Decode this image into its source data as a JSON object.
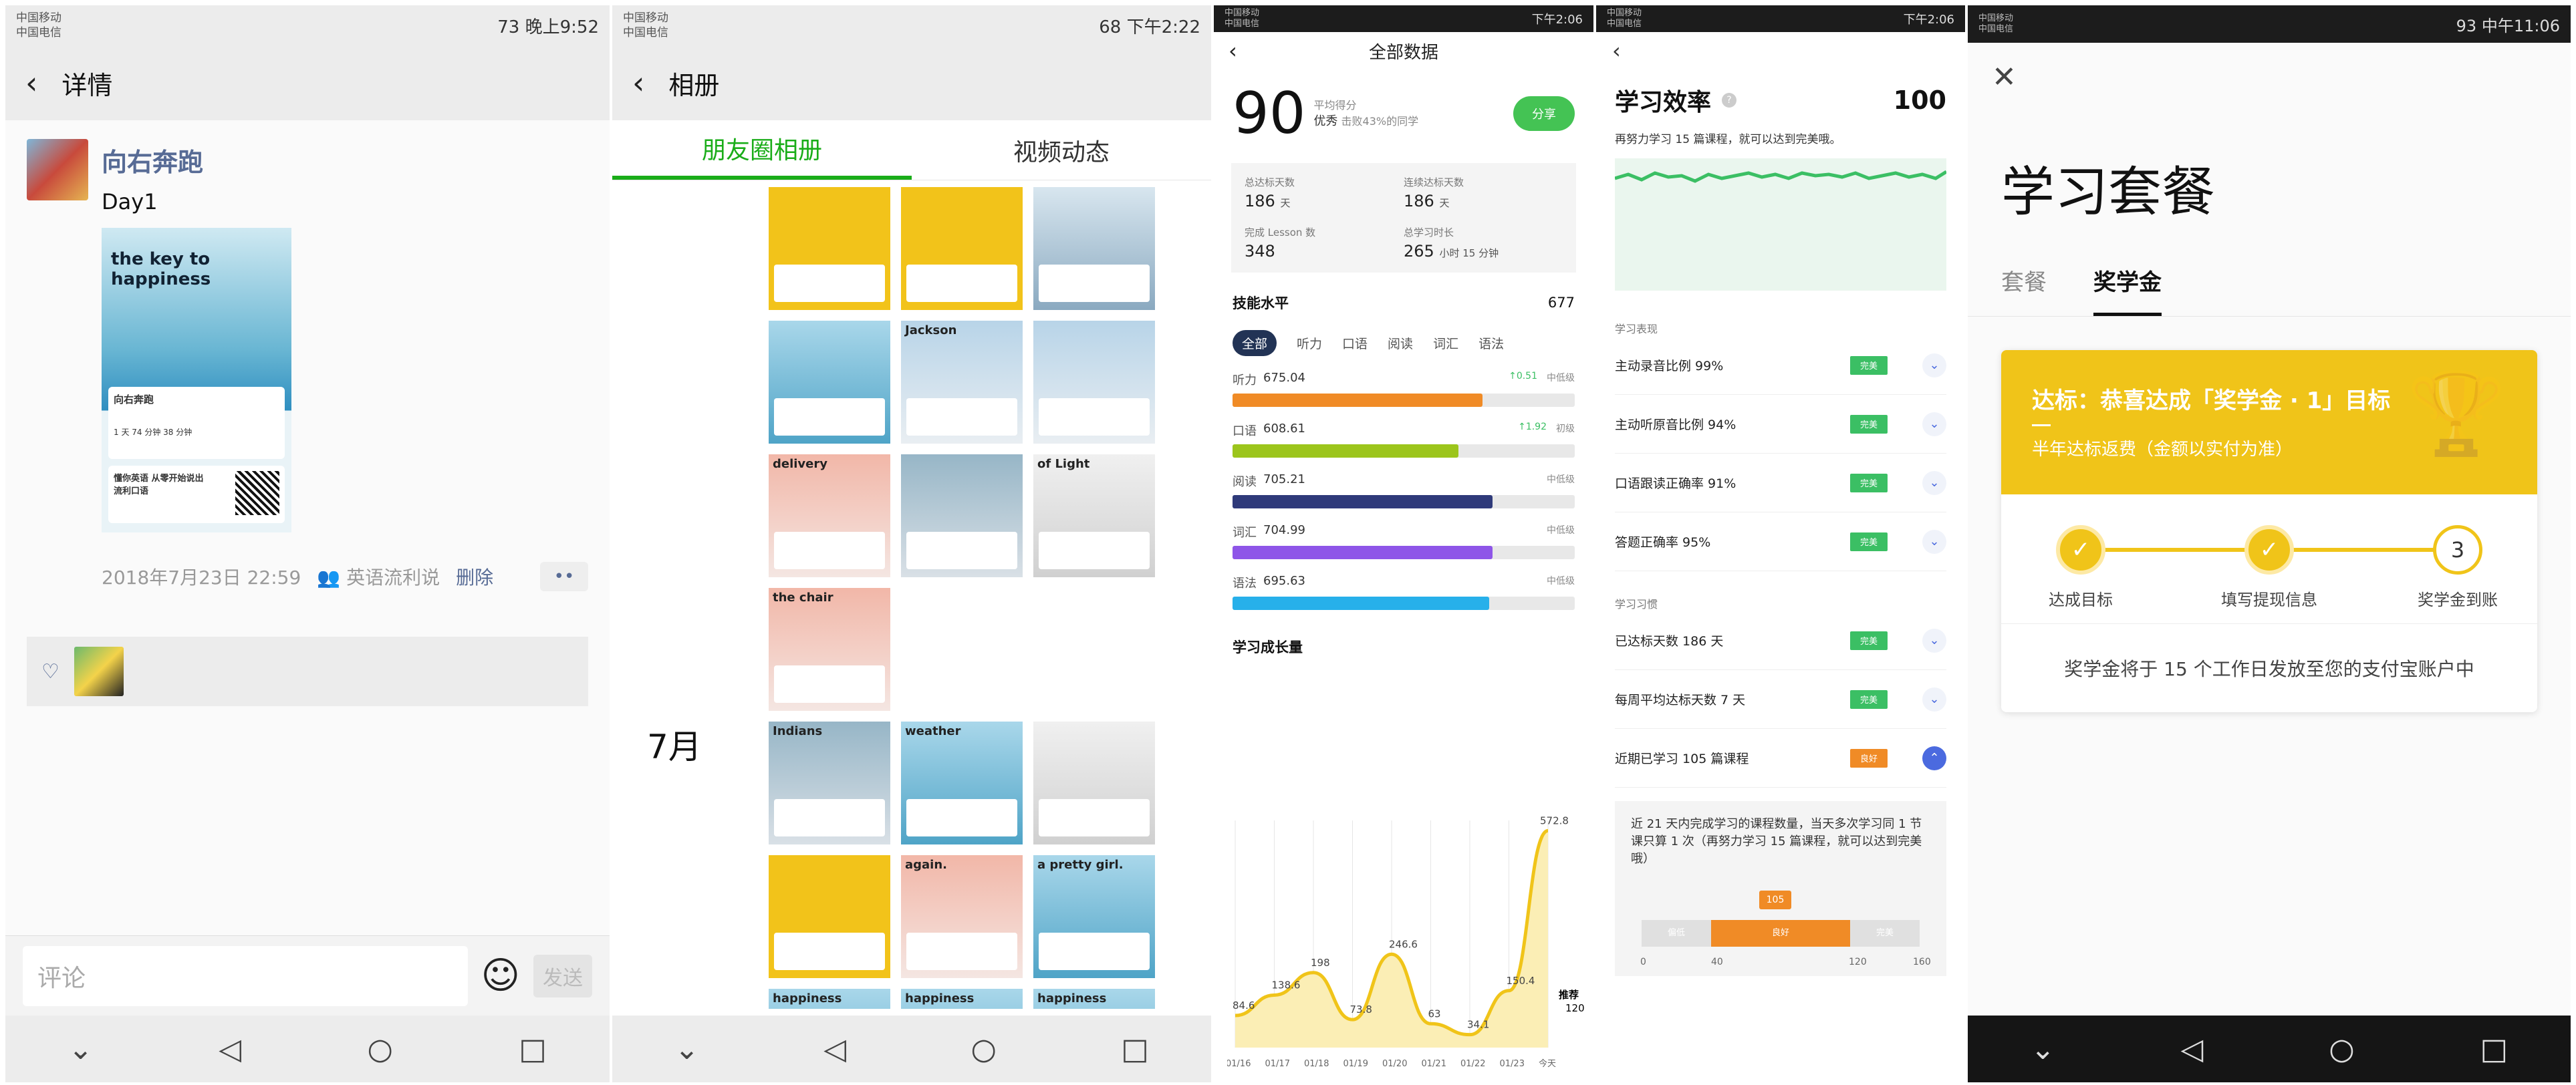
{
  "p1": {
    "status": {
      "op1": "中国移动",
      "op2": "中国电信",
      "right": "73 晚上9:52"
    },
    "title": "详情",
    "author": "向右奔跑",
    "text": "Day1",
    "poster": {
      "title": "the key to happiness",
      "card_name": "向右奔跑",
      "card_stats": "1 天   74 分钟   38 分钟",
      "card2": "懂你英语 从零开始说出流利口语"
    },
    "time": "2018年7月23日 22:59",
    "group": "英语流利说",
    "delete": "删除",
    "comment_placeholder": "评论",
    "send": "发送"
  },
  "p2": {
    "status": {
      "op1": "中国移动",
      "op2": "中国电信",
      "right": "68 下午2:22"
    },
    "title": "相册",
    "tab1": "朋友圈相册",
    "tab2": "视频动态",
    "month": "7月",
    "thumb_labels": [
      "",
      "",
      "",
      "",
      "Jackson",
      "",
      "delivery",
      "",
      "of Light",
      "the chair",
      "Indians",
      "weather",
      "",
      "",
      "again.",
      "a pretty girl.",
      "happiness",
      "happiness",
      "happiness"
    ]
  },
  "p3": {
    "status": {
      "op1": "中国移动",
      "op2": "中国电信",
      "right": "下午2:06"
    },
    "title": "全部数据",
    "score": "90",
    "score_label": "平均得分",
    "grade": "优秀",
    "beat": "击败43%的同学",
    "share": "分享",
    "stats": [
      {
        "label": "总达标天数",
        "value": "186",
        "unit": "天"
      },
      {
        "label": "连续达标天数",
        "value": "186",
        "unit": "天"
      },
      {
        "label": "完成 Lesson 数",
        "value": "348",
        "unit": ""
      },
      {
        "label": "总学习时长",
        "value": "265",
        "unit": "小时 15 分钟"
      }
    ],
    "skill_title": "技能水平",
    "skill_total": "677",
    "chips": [
      "全部",
      "听力",
      "口语",
      "阅读",
      "词汇",
      "语法"
    ],
    "skills": [
      {
        "name": "听力",
        "value": "675.04",
        "up": "↑0.51",
        "level": "中低级",
        "color": "#f08b26",
        "frac": 0.73
      },
      {
        "name": "口语",
        "value": "608.61",
        "up": "↑1.92",
        "level": "初级",
        "color": "#9cc51c",
        "frac": 0.66
      },
      {
        "name": "阅读",
        "value": "705.21",
        "up": "",
        "level": "中低级",
        "color": "#2f3a7a",
        "frac": 0.76
      },
      {
        "name": "词汇",
        "value": "704.99",
        "up": "",
        "level": "中低级",
        "color": "#8e55e8",
        "frac": 0.76
      },
      {
        "name": "语法",
        "value": "695.63",
        "up": "",
        "level": "中低级",
        "color": "#27b0ea",
        "frac": 0.75
      }
    ],
    "growth_title": "学习成长量",
    "recommend": "推荐",
    "recommend_value": "120",
    "chart_data": {
      "type": "area",
      "title": "学习成长量",
      "categories": [
        "01/16",
        "01/17",
        "01/18",
        "01/19",
        "01/20",
        "01/21",
        "01/22",
        "01/23",
        "今天"
      ],
      "values": [
        84.6,
        138.6,
        198,
        73.8,
        246.6,
        63,
        34.1,
        150.4,
        572.8
      ],
      "ylim": [
        0,
        600
      ],
      "color": "#f0c419"
    }
  },
  "p4": {
    "status": {
      "op1": "中国移动",
      "op2": "中国电信",
      "right": "下午2:06"
    },
    "title": "学习效率",
    "score": "100",
    "desc": "再努力学习 15 篇课程，就可以达到完美哦。",
    "group1": "学习表现",
    "group2": "学习习惯",
    "items1": [
      {
        "label": "主动录音比例 99%",
        "tag": "完美"
      },
      {
        "label": "主动听原音比例 94%",
        "tag": "完美"
      },
      {
        "label": "口语跟读正确率 91%",
        "tag": "完美"
      },
      {
        "label": "答题正确率 95%",
        "tag": "完美"
      }
    ],
    "items2": [
      {
        "label": "已达标天数 186 天",
        "tag": "完美"
      },
      {
        "label": "每周平均达标天数 7 天",
        "tag": "完美"
      },
      {
        "label": "近期已学习 105 篇课程",
        "tag": "良好"
      }
    ],
    "note": "近 21 天内完成学习的课程数量，当天多次学习同 1 节课只算 1 次（再努力学习 15 篇课程，就可以达到完美哦）",
    "marker": "105",
    "scale": [
      "偏低",
      "良好",
      "完美"
    ],
    "scale_ticks": [
      "0",
      "40",
      "120",
      "160"
    ]
  },
  "p5": {
    "status": {
      "op1": "中国移动",
      "op2": "中国电信",
      "right": "93 中午11:06"
    },
    "title": "学习套餐",
    "tab1": "套餐",
    "tab2": "奖学金",
    "head": "达标：恭喜达成「奖学金 · 1」目标",
    "sub": "半年达标返费（金额以实付为准）",
    "steps": [
      "达成目标",
      "填写提现信息",
      "奖学金到账"
    ],
    "step3": "3",
    "foot": "奖学金将于 15 个工作日发放至您的支付宝账户中"
  }
}
